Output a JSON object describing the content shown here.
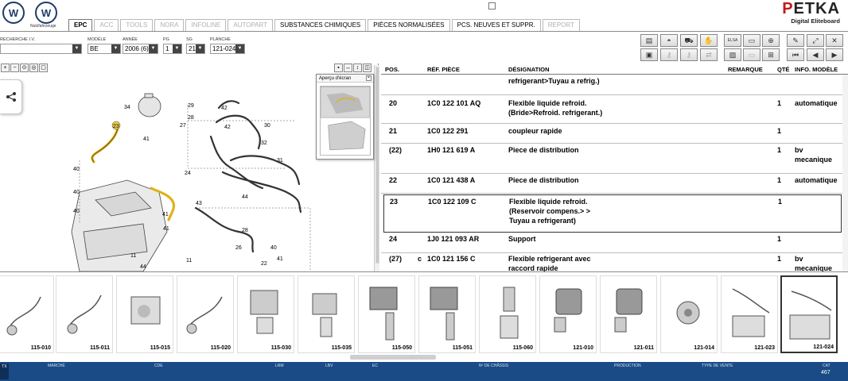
{
  "header": {
    "brand_sub": "Nutzfahrzeuge",
    "tabs": [
      {
        "label": "EPC"
      },
      {
        "label": "ACC"
      },
      {
        "label": "TOOLS"
      },
      {
        "label": "NORA"
      },
      {
        "label": "INFOLINE"
      },
      {
        "label": "AUTOPART"
      },
      {
        "label": "SUBSTANCES CHIMIQUES"
      },
      {
        "label": "PIÈCES NORMALISÉES"
      },
      {
        "label": "PCS. NEUVES ET SUPPR."
      },
      {
        "label": "REPORT"
      }
    ],
    "petka_name_first": "P",
    "petka_name_rest": "ETKA",
    "petka_sub": "Digital Eliteboard"
  },
  "filters": {
    "recherche": {
      "label": "RECHERCHE I.V.",
      "value": ""
    },
    "modele": {
      "label": "MODÈLE",
      "value": "BE"
    },
    "annee": {
      "label": "ANNÉE",
      "value": "2006 (6)"
    },
    "pg": {
      "label": "PG",
      "value": "1"
    },
    "sg": {
      "label": "SG",
      "value": "21"
    },
    "planche": {
      "label": "PLANCHE",
      "value": "121-024"
    }
  },
  "toolbar": {
    "elsa_label": "ELSA"
  },
  "overview": {
    "title": "Aperçu d'écran"
  },
  "diagram": {
    "callouts": [
      "34",
      "29",
      "23",
      "28",
      "27",
      "42",
      "42",
      "30",
      "41",
      "32",
      "31",
      "40",
      "24",
      "43",
      "44",
      "40",
      "41",
      "41",
      "40",
      "11",
      "44",
      "22",
      "40",
      "41",
      "26",
      "28",
      "11"
    ]
  },
  "table": {
    "headers": {
      "pos": "POS.",
      "ref": "RÉF. PIÈCE",
      "desig": "DÉSIGNATION",
      "remarque": "REMARQUE",
      "qte": "QTÉ",
      "info": "INFO. MODÈLE"
    },
    "rows": [
      {
        "pos": "",
        "flag": "",
        "ref": "",
        "desig": [
          "refrigerant>Tuyau a refrig.)"
        ],
        "qte": "",
        "info": []
      },
      {
        "pos": "20",
        "flag": "",
        "ref": "1C0 122 101 AQ",
        "desig": [
          "Flexible liquide refroid.",
          "(Bride>Refroid. refrigerant.)"
        ],
        "qte": "1",
        "info": [
          "automatique"
        ]
      },
      {
        "pos": "21",
        "flag": "",
        "ref": "1C0 122 291",
        "desig": [
          "coupleur rapide"
        ],
        "qte": "1",
        "info": []
      },
      {
        "pos": "(22)",
        "flag": "",
        "ref": "1H0 121 619 A",
        "desig": [
          "Piece de distribution"
        ],
        "qte": "1",
        "info": [
          "bv",
          "mecanique"
        ]
      },
      {
        "pos": "22",
        "flag": "",
        "ref": "1C0 121 438 A",
        "desig": [
          "Piece de distribution"
        ],
        "qte": "1",
        "info": [
          "automatique"
        ]
      },
      {
        "pos": "23",
        "flag": "",
        "ref": "1C0 122 109 C",
        "desig": [
          "Flexible liquide refroid.",
          "(Reservoir compens.> >",
          " Tuyau a refrigerant)"
        ],
        "qte": "1",
        "info": []
      },
      {
        "pos": "24",
        "flag": "",
        "ref": "1J0 121 093 AR",
        "desig": [
          "Support"
        ],
        "qte": "1",
        "info": []
      },
      {
        "pos": "(27)",
        "flag": "c",
        "ref": "1C0 121 156 C",
        "desig": [
          "Flexible refrigerant avec",
          "raccord rapide"
        ],
        "qte": "1",
        "info": [
          "bv",
          "mecanique"
        ]
      }
    ]
  },
  "thumbnails": [
    {
      "label": "115-010"
    },
    {
      "label": "115-011"
    },
    {
      "label": "115-015"
    },
    {
      "label": "115-020"
    },
    {
      "label": "115-030"
    },
    {
      "label": "115-035"
    },
    {
      "label": "115-050"
    },
    {
      "label": "115-051"
    },
    {
      "label": "115-060"
    },
    {
      "label": "121-010"
    },
    {
      "label": "121-011"
    },
    {
      "label": "121-014"
    },
    {
      "label": "121-023"
    },
    {
      "label": "121-024"
    }
  ],
  "status": {
    "logo": "TX",
    "marche": "MARCHÉ",
    "cde": "CDE",
    "lrm": "LRM",
    "lbv": "LBV",
    "ec": "EC",
    "chassis": "Nº DE CHÂSSIS",
    "production": "PRODUCTION",
    "type_vente": "TYPE DE VENTE",
    "cat": "CAT",
    "cat_value": "467"
  },
  "colors": {
    "status_bar": "#1b4b86",
    "highlight_hose": "#e0b21a",
    "petka_red": "#c01a1a"
  }
}
